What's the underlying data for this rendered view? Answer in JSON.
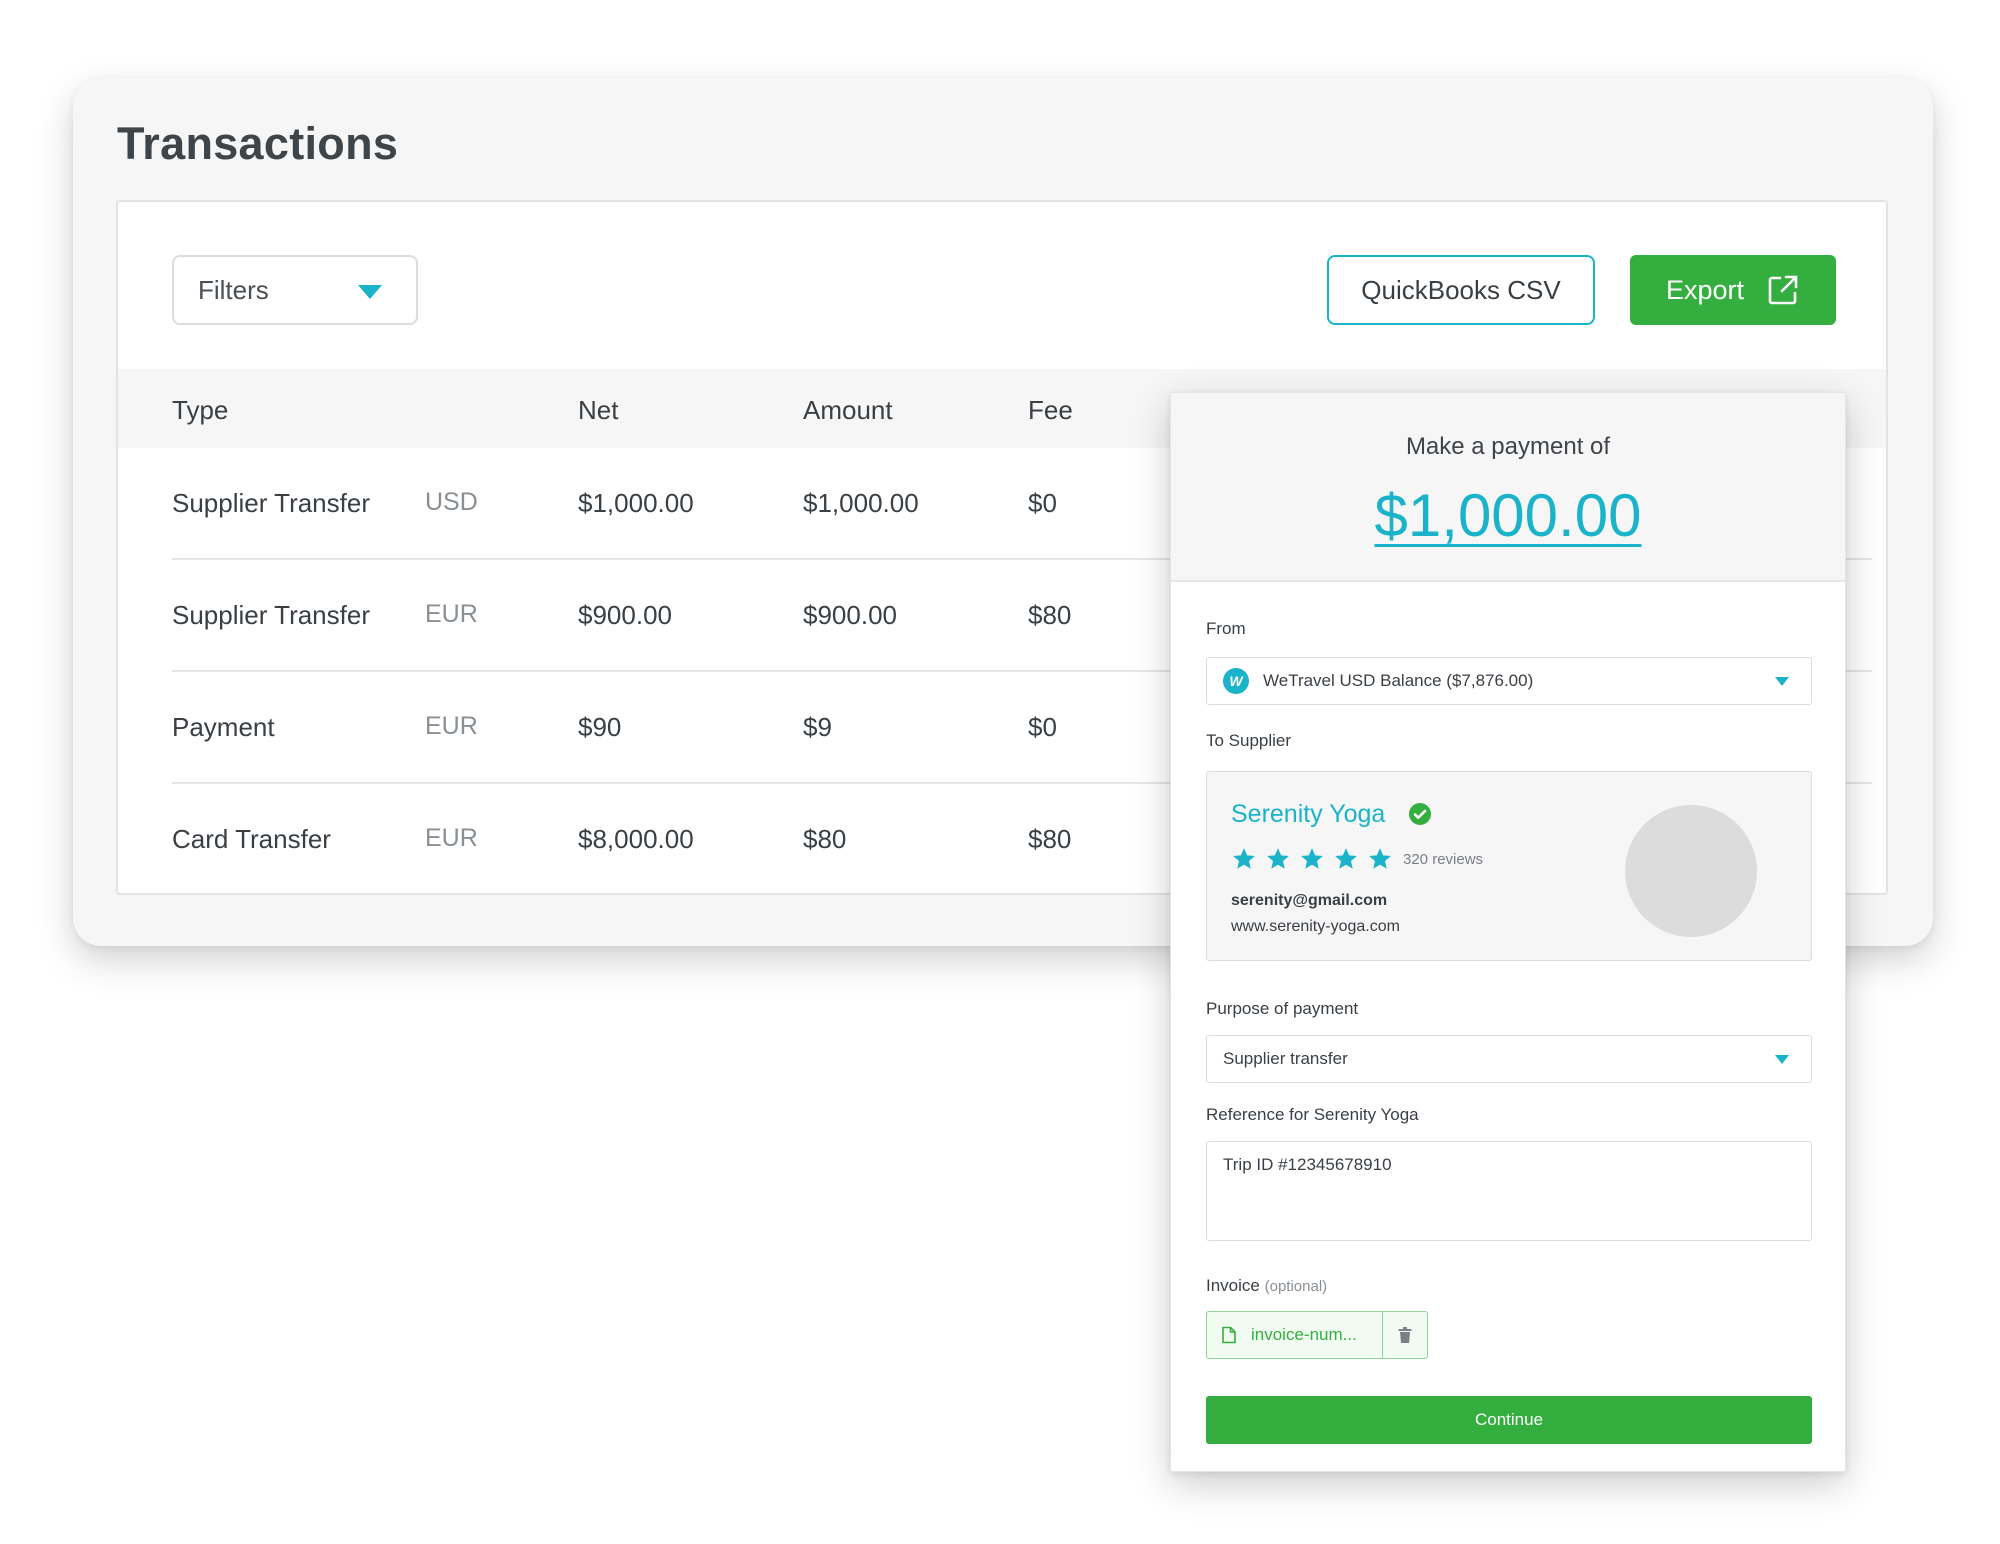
{
  "page": {
    "title": "Transactions"
  },
  "toolbar": {
    "filters_label": "Filters",
    "quickbooks_label": "QuickBooks CSV",
    "export_label": "Export"
  },
  "table": {
    "columns": [
      "Type",
      "Net",
      "Amount",
      "Fee"
    ],
    "rows": [
      {
        "type": "Supplier Transfer",
        "currency": "USD",
        "net": "$1,000.00",
        "amount": "$1,000.00",
        "fee": "$0"
      },
      {
        "type": "Supplier Transfer",
        "currency": "EUR",
        "net": "$900.00",
        "amount": "$900.00",
        "fee": "$80"
      },
      {
        "type": "Payment",
        "currency": "EUR",
        "net": "$90",
        "amount": "$9",
        "fee": "$0"
      },
      {
        "type": "Card Transfer",
        "currency": "EUR",
        "net": "$8,000.00",
        "amount": "$80",
        "fee": "$80"
      }
    ]
  },
  "payment": {
    "lead": "Make a payment of",
    "amount": "$1,000.00",
    "from_label": "From",
    "from_value": "WeTravel USD Balance ($7,876.00)",
    "to_label": "To Supplier",
    "supplier": {
      "name": "Serenity Yoga",
      "rating": 5,
      "reviews": "320 reviews",
      "email": "serenity@gmail.com",
      "website": "www.serenity-yoga.com"
    },
    "purpose_label": "Purpose of payment",
    "purpose_value": "Supplier transfer",
    "reference_label": "Reference for Serenity Yoga",
    "reference_value": "Trip ID #12345678910",
    "invoice_label": "Invoice",
    "invoice_optional": "(optional)",
    "invoice_file": "invoice-num...",
    "continue_label": "Continue"
  },
  "colors": {
    "accent": "#1bb3c9",
    "primary_green": "#34ae3e",
    "star": "#1bb3c9"
  }
}
